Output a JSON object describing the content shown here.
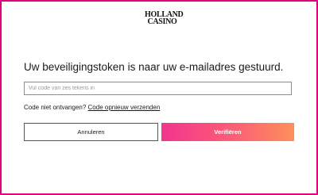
{
  "brand": {
    "logo_line1": "HOLLAND",
    "logo_line2": "CASINO",
    "frame_color": "#e4007c"
  },
  "main": {
    "heading": "Uw beveiligingstoken is naar uw e-mailadres gestuurd.",
    "code_field": {
      "placeholder": "Vul code van zes tekens in",
      "value": ""
    },
    "resend": {
      "prompt": "Code niet ontvangen?",
      "link_label": "Code opnieuw verzenden"
    },
    "buttons": {
      "cancel_label": "Annuleren",
      "verify_label": "Verifiëren"
    }
  },
  "colors": {
    "verify_gradient_start": "#f2358d",
    "verify_gradient_end": "#fd8f5c"
  }
}
